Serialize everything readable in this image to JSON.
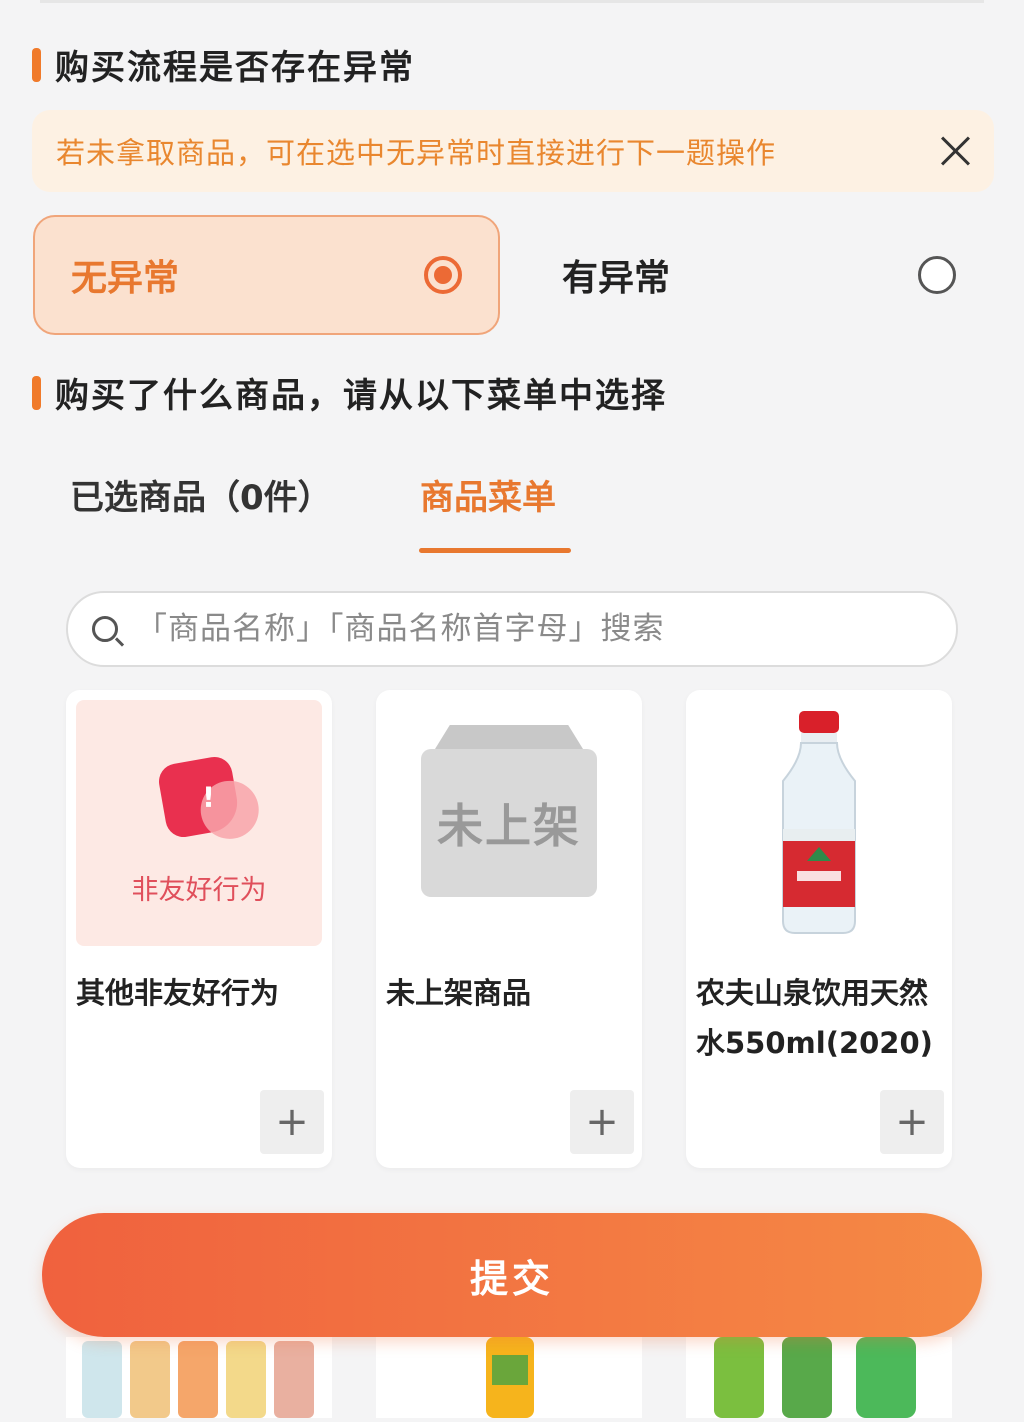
{
  "section1": {
    "title": "购买流程是否存在异常"
  },
  "notice": {
    "text": "若未拿取商品，可在选中无异常时直接进行下一题操作"
  },
  "options": [
    {
      "label": "无异常",
      "selected": true
    },
    {
      "label": "有异常",
      "selected": false
    }
  ],
  "section2": {
    "title": "购买了什么商品，请从以下菜单中选择"
  },
  "tabs": [
    {
      "label": "已选商品（0件）",
      "active": false
    },
    {
      "label": "商品菜单",
      "active": true
    }
  ],
  "search": {
    "placeholder": "「商品名称」「商品名称首字母」搜索"
  },
  "products": [
    {
      "name": "其他非友好行为",
      "image_text": "非友好行为",
      "icon": "warning-icon"
    },
    {
      "name": "未上架商品",
      "image_text": "未上架",
      "icon": "box-icon"
    },
    {
      "name": "农夫山泉饮用天然水550ml(2020)",
      "icon": "water-bottle-icon"
    }
  ],
  "submit": {
    "label": "提交"
  },
  "colors": {
    "accent": "#e8782f",
    "submit_start": "#f0613e",
    "submit_end": "#f58a45"
  }
}
